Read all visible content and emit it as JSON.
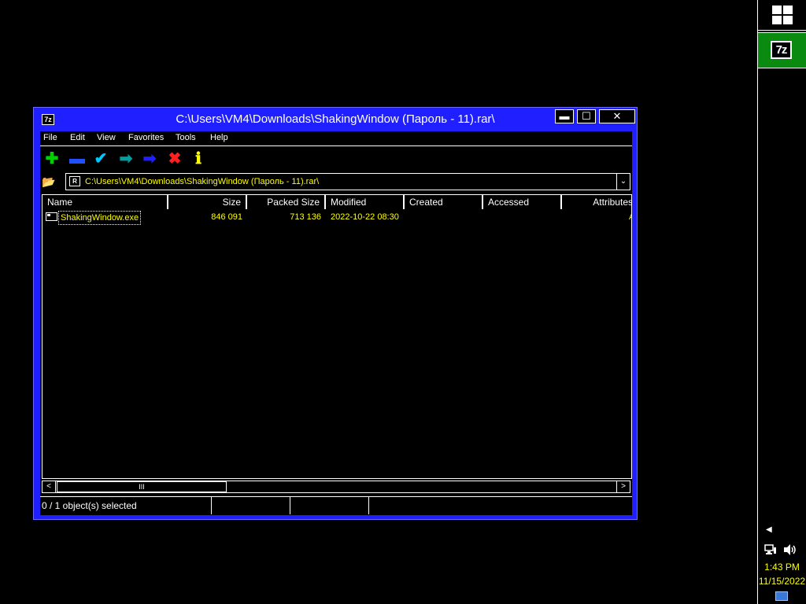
{
  "window": {
    "title": "C:\\Users\\VM4\\Downloads\\ShakingWindow (Пароль - 11).rar\\",
    "app_icon": "7z",
    "controls": {
      "minimize": "▬",
      "maximize": "☐",
      "close": "✕"
    }
  },
  "menu": [
    "File",
    "Edit",
    "View",
    "Favorites",
    "Tools",
    "Help"
  ],
  "toolbar": [
    {
      "name": "add-icon",
      "glyph": "✚",
      "color": "#00d000"
    },
    {
      "name": "extract-icon",
      "glyph": "▬",
      "color": "#2050ff"
    },
    {
      "name": "test-icon",
      "glyph": "✔",
      "color": "#00c8ff"
    },
    {
      "name": "copy-icon",
      "glyph": "➡",
      "color": "#00a0a0"
    },
    {
      "name": "move-icon",
      "glyph": "➡",
      "color": "#2020ff"
    },
    {
      "name": "delete-icon",
      "glyph": "✖",
      "color": "#ff2020"
    },
    {
      "name": "info-icon",
      "glyph": "ℹ",
      "color": "#ffff00"
    }
  ],
  "address": {
    "path": "C:\\Users\\VM4\\Downloads\\ShakingWindow (Пароль - 11).rar\\"
  },
  "columns": [
    "Name",
    "Size",
    "Packed Size",
    "Modified",
    "Created",
    "Accessed",
    "Attributes"
  ],
  "files": [
    {
      "name": "ShakingWindow.exe",
      "size": "846 091",
      "packed_size": "713 136",
      "modified": "2022-10-22 08:30",
      "created": "",
      "accessed": "",
      "attributes": "A"
    }
  ],
  "status": {
    "selection": "0 / 1 object(s) selected"
  },
  "taskbar": {
    "start_icon": "windows-logo",
    "app_label": "7z",
    "time": "1:43 PM",
    "date": "11/15/2022"
  },
  "colors": {
    "window_frame": "#1f1fff",
    "text_highlight": "#ffff00",
    "taskbar_app": "#0a8a10"
  }
}
